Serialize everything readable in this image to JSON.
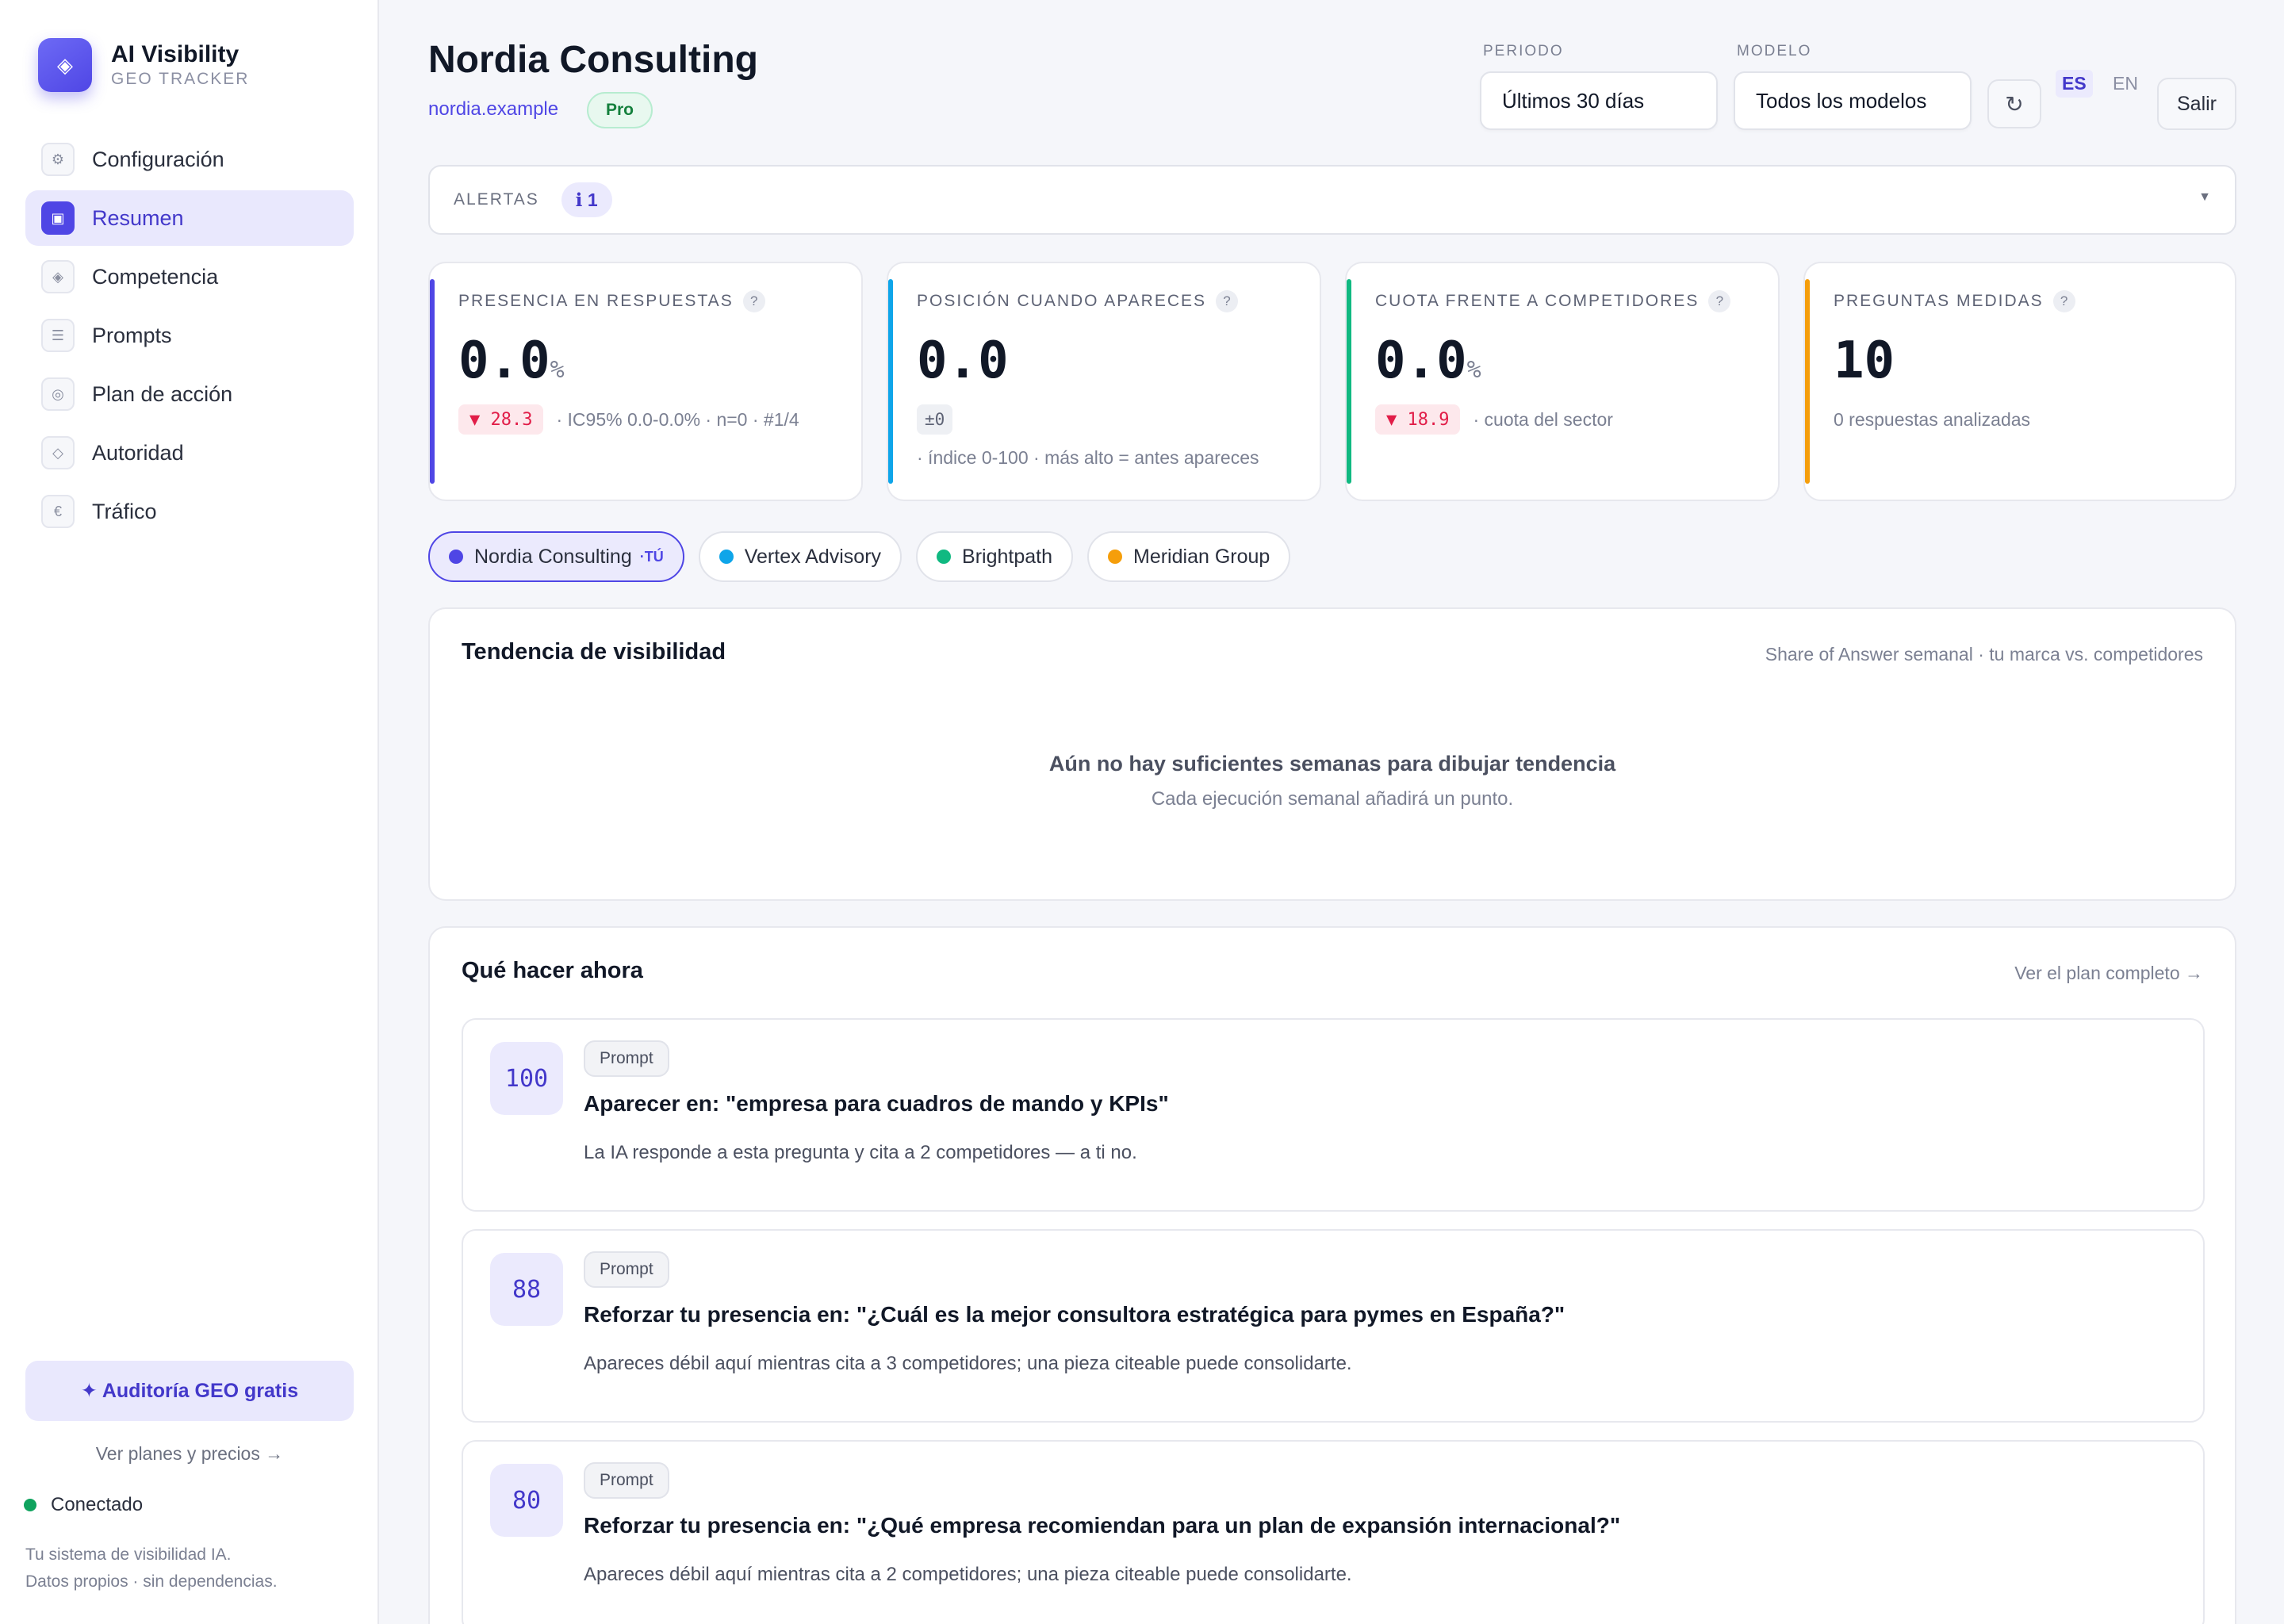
{
  "brand": {
    "title": "AI Visibility",
    "subtitle": "GEO TRACKER",
    "logo_icon": "diamond-icon"
  },
  "nav": [
    {
      "label": "Configuración",
      "icon": "gear-icon",
      "glyph": "⚙",
      "active": false
    },
    {
      "label": "Resumen",
      "icon": "dashboard-icon",
      "glyph": "▣",
      "active": true
    },
    {
      "label": "Competencia",
      "icon": "diamond-icon",
      "glyph": "◈",
      "active": false
    },
    {
      "label": "Prompts",
      "icon": "list-icon",
      "glyph": "☰",
      "active": false
    },
    {
      "label": "Plan de acción",
      "icon": "target-icon",
      "glyph": "◎",
      "active": false
    },
    {
      "label": "Autoridad",
      "icon": "diamond-outline-icon",
      "glyph": "◇",
      "active": false
    },
    {
      "label": "Tráfico",
      "icon": "euro-icon",
      "glyph": "€",
      "active": false
    }
  ],
  "sidebar_footer": {
    "audit_button": "✦ Auditoría GEO gratis",
    "plans_link": "Ver planes y precios →",
    "status": "Conectado",
    "tagline_1": "Tu sistema de visibilidad IA.",
    "tagline_2": "Datos propios · sin dependencias."
  },
  "header": {
    "title": "Nordia Consulting",
    "domain": "nordia.example",
    "plan": "Pro",
    "period_label": "PERIODO",
    "period_value": "Últimos 30 días",
    "model_label": "MODELO",
    "model_value": "Todos los modelos",
    "refresh_icon": "refresh-icon",
    "lang_es": "ES",
    "lang_en": "EN",
    "logout": "Salir"
  },
  "alerts": {
    "label": "ALERTAS",
    "count": "ℹ 1"
  },
  "kpis": [
    {
      "label": "PRESENCIA EN RESPUESTAS",
      "value": "0.0",
      "unit": "%",
      "delta": "▼ 28.3",
      "detail": "· IC95% 0.0-0.0% · n=0 · #1/4",
      "accent": "#4f46e5"
    },
    {
      "label": "POSICIÓN CUANDO APARECES",
      "value": "0.0",
      "unit": "",
      "delta": "±0",
      "detail": "· índice 0-100 · más alto = antes apareces",
      "accent": "#0ea5e9"
    },
    {
      "label": "CUOTA FRENTE A COMPETIDORES",
      "value": "0.0",
      "unit": "%",
      "delta": "▼ 18.9",
      "detail": "· cuota del sector",
      "accent": "#10b981"
    },
    {
      "label": "PREGUNTAS MEDIDAS",
      "value": "10",
      "unit": "",
      "delta": "",
      "detail": "0 respuestas analizadas",
      "accent": "#f59e0b"
    }
  ],
  "brands": [
    {
      "name": "Nordia Consulting",
      "suffix": "·TÚ",
      "color": "#4f46e5",
      "active": true
    },
    {
      "name": "Vertex Advisory",
      "color": "#0ea5e9",
      "active": false
    },
    {
      "name": "Brightpath",
      "color": "#10b981",
      "active": false
    },
    {
      "name": "Meridian Group",
      "color": "#f59e0b",
      "active": false
    }
  ],
  "trend": {
    "title": "Tendencia de visibilidad",
    "subtitle": "Share of Answer semanal · tu marca vs. competidores",
    "empty_title": "Aún no hay suficientes semanas para dibujar tendencia",
    "empty_sub": "Cada ejecución semanal añadirá un punto."
  },
  "actions": {
    "title": "Qué hacer ahora",
    "link": "Ver el plan completo →",
    "items": [
      {
        "score": "100",
        "tag": "Prompt",
        "title": "Aparecer en: \"empresa para cuadros de mando y KPIs\"",
        "desc": "La IA responde a esta pregunta y cita a 2 competidores — a ti no."
      },
      {
        "score": "88",
        "tag": "Prompt",
        "title": "Reforzar tu presencia en: \"¿Cuál es la mejor consultora estratégica para pymes en España?\"",
        "desc": "Apareces débil aquí mientras cita a 3 competidores; una pieza citeable puede consolidarte."
      },
      {
        "score": "80",
        "tag": "Prompt",
        "title": "Reforzar tu presencia en: \"¿Qué empresa recomiendan para un plan de expansión internacional?\"",
        "desc": "Apareces débil aquí mientras cita a 2 competidores; una pieza citeable puede consolidarte."
      }
    ]
  }
}
